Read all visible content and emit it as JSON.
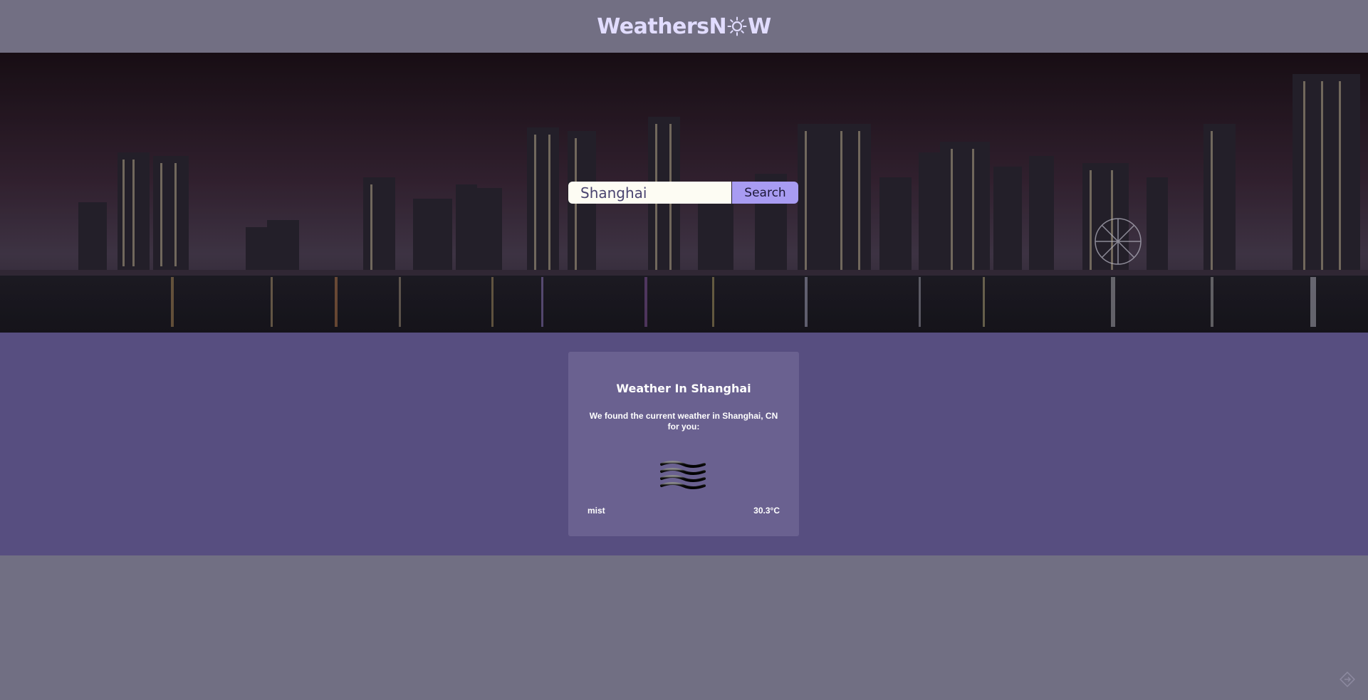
{
  "header": {
    "logo_part1": "WeathersN",
    "logo_part2": "W",
    "logo_icon": "sun-icon"
  },
  "hero": {
    "background": "night city skyline with waterfront reflections",
    "search": {
      "value": "Shanghai",
      "button_label": "Search"
    }
  },
  "card": {
    "title": "Weather In Shanghai",
    "description": "We found the current weather in Shanghai, CN for you:",
    "icon": "mist-icon",
    "condition": "mist",
    "temperature": "30.3°C"
  },
  "colors": {
    "header_bg": "#726f83",
    "logo": "#e1dcff",
    "results_bg": "#574e80",
    "card_bg": "#6a6190",
    "search_button": "#a89cf2",
    "search_input": "#fdfcf3"
  }
}
